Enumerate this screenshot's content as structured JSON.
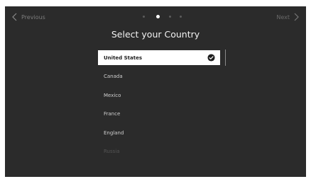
{
  "nav": {
    "previous_label": "Previous",
    "next_label": "Next"
  },
  "pager": {
    "total_steps": 4,
    "current_step": 2
  },
  "title": "Select your Country",
  "countries": [
    {
      "label": "United States",
      "selected": true
    },
    {
      "label": "Canada",
      "selected": false
    },
    {
      "label": "Mexico",
      "selected": false
    },
    {
      "label": "France",
      "selected": false
    },
    {
      "label": "England",
      "selected": false
    },
    {
      "label": "Russia",
      "selected": false
    }
  ],
  "colors": {
    "background": "#2b2b2b",
    "selected_background": "#ffffff",
    "text": "#cfcfcf",
    "accent": "#ffffff"
  }
}
